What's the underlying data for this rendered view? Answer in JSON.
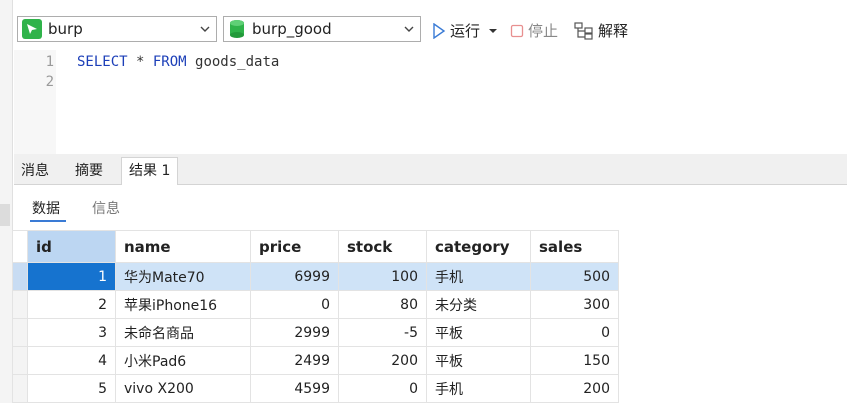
{
  "toolbar": {
    "connection": "burp",
    "database": "burp_good",
    "run_label": "运行",
    "stop_label": "停止",
    "explain_label": "解释",
    "colors": {
      "connection_icon": "#2fb34a",
      "database_icon": "#2fb34a",
      "run_icon": "#3a7bd5"
    }
  },
  "editor": {
    "line_numbers": [
      "1",
      "2"
    ],
    "sql": {
      "kw_select": "SELECT",
      "star": " * ",
      "kw_from": "FROM",
      "table": " goods_data"
    }
  },
  "result_tabs": [
    {
      "label": "消息"
    },
    {
      "label": "摘要"
    },
    {
      "label": "结果 1",
      "active": true
    }
  ],
  "sub_tabs": [
    {
      "label": "数据",
      "active": true
    },
    {
      "label": "信息"
    }
  ],
  "grid": {
    "columns": [
      "id",
      "name",
      "price",
      "stock",
      "category",
      "sales"
    ],
    "rows": [
      [
        "1",
        "华为Mate70",
        "6999",
        "100",
        "手机",
        "500"
      ],
      [
        "2",
        "苹果iPhone16",
        "0",
        "80",
        "未分类",
        "300"
      ],
      [
        "3",
        "未命名商品",
        "2999",
        "-5",
        "平板",
        "0"
      ],
      [
        "4",
        "小米Pad6",
        "2499",
        "200",
        "平板",
        "150"
      ],
      [
        "5",
        "vivo X200",
        "4599",
        "0",
        "手机",
        "200"
      ]
    ],
    "selected_row": 0,
    "colors": {
      "selection": "#cfe3f7",
      "focus": "#1673cf",
      "header_selected": "#bcd6f2"
    }
  }
}
